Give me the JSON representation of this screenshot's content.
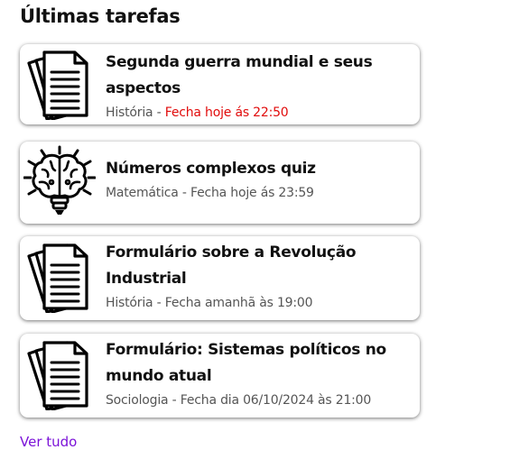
{
  "section": {
    "title": "Últimas tarefas"
  },
  "tasks": [
    {
      "icon": "document-stack-icon",
      "title": "Segunda guerra mundial e seus aspectos",
      "subject": "História",
      "separator": " - ",
      "due": "Fecha hoje ás 22:50",
      "due_color": "#e10b0b"
    },
    {
      "icon": "brain-lightbulb-icon",
      "title": "Números complexos quiz",
      "subject": "Matemática",
      "separator": " - ",
      "due": "Fecha hoje ás 23:59"
    },
    {
      "icon": "document-stack-icon",
      "title": "Formulário sobre a Revolução Industrial",
      "subject": "História",
      "separator": " - ",
      "due": "Fecha amanhã às 19:00"
    },
    {
      "icon": "document-stack-icon",
      "title": "Formulário: Sistemas políticos no mundo atual",
      "subject": "Sociologia",
      "separator": " - ",
      "due": "Fecha dia 06/10/2024 às 21:00"
    }
  ],
  "footer": {
    "see_all_label": "Ver tudo",
    "link_color": "#7b12d8"
  }
}
